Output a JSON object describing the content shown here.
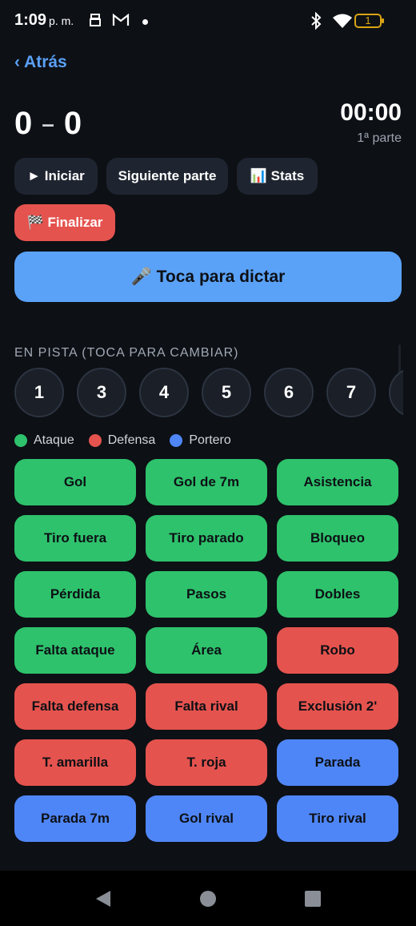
{
  "status_bar": {
    "time": "1:09",
    "ampm": "p. m.",
    "battery": "1"
  },
  "header": {
    "back_label": "‹ Atrás"
  },
  "scoreboard": {
    "home": "0",
    "separator": "–",
    "away": "0",
    "clock": "00:00",
    "period": "1ª parte"
  },
  "controls": {
    "start": "► Iniciar",
    "next_period": "Siguiente parte",
    "stats": "📊 Stats",
    "finish": "🏁 Finalizar",
    "dictate": "🎤 Toca para dictar"
  },
  "on_court": {
    "label": "EN PISTA (TOCA PARA CAMBIAR)",
    "players": [
      "1",
      "3",
      "4",
      "5",
      "6",
      "7",
      ""
    ]
  },
  "legend": [
    {
      "label": "Ataque",
      "color": "#2ec26c"
    },
    {
      "label": "Defensa",
      "color": "#e5534e"
    },
    {
      "label": "Portero",
      "color": "#4f86f7"
    }
  ],
  "actions": [
    {
      "label": "Gol",
      "category": "ataque"
    },
    {
      "label": "Gol de 7m",
      "category": "ataque"
    },
    {
      "label": "Asistencia",
      "category": "ataque"
    },
    {
      "label": "Tiro fuera",
      "category": "ataque"
    },
    {
      "label": "Tiro parado",
      "category": "ataque"
    },
    {
      "label": "Bloqueo",
      "category": "ataque"
    },
    {
      "label": "Pérdida",
      "category": "ataque"
    },
    {
      "label": "Pasos",
      "category": "ataque"
    },
    {
      "label": "Dobles",
      "category": "ataque"
    },
    {
      "label": "Falta ataque",
      "category": "ataque"
    },
    {
      "label": "Área",
      "category": "ataque"
    },
    {
      "label": "Robo",
      "category": "defensa"
    },
    {
      "label": "Falta defensa",
      "category": "defensa"
    },
    {
      "label": "Falta rival",
      "category": "defensa"
    },
    {
      "label": "Exclusión 2'",
      "category": "defensa"
    },
    {
      "label": "T. amarilla",
      "category": "defensa"
    },
    {
      "label": "T. roja",
      "category": "defensa"
    },
    {
      "label": "Parada",
      "category": "portero"
    },
    {
      "label": "Parada 7m",
      "category": "portero"
    },
    {
      "label": "Gol rival",
      "category": "portero"
    },
    {
      "label": "Tiro rival",
      "category": "portero"
    }
  ]
}
